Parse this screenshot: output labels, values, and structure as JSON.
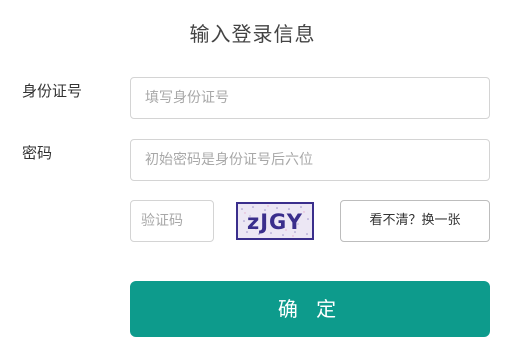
{
  "form": {
    "title": "输入登录信息",
    "id_number": {
      "label": "身份证号",
      "placeholder": "填写身份证号",
      "value": ""
    },
    "password": {
      "label": "密码",
      "placeholder": "初始密码是身份证号后六位",
      "value": ""
    },
    "captcha": {
      "placeholder": "验证码",
      "value": "",
      "image_text": "zJGY",
      "refresh_label": "看不清？换一张"
    },
    "submit_label": "确 定"
  },
  "colors": {
    "accent": "#0d9b8c",
    "captcha_text": "#3a2e8c",
    "input_border": "#d4d4d4"
  }
}
